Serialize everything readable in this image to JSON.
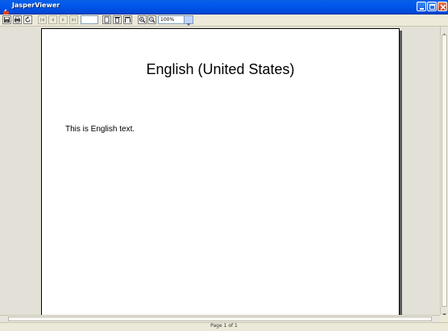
{
  "window": {
    "title": "JasperViewer"
  },
  "toolbar": {
    "zoom_value": "100%"
  },
  "report": {
    "title": "English (United States)",
    "body_text": "This is English text."
  },
  "status": {
    "page_label": "Page 1 of 1"
  },
  "colors": {
    "titlebar": "#0054e3",
    "close_button": "#c43a19",
    "toolbar": "#ece9d8",
    "view_background": "#e3e1d7"
  }
}
